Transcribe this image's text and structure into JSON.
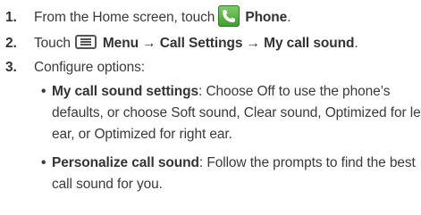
{
  "steps": [
    {
      "number": "1.",
      "text_before": "From the Home screen, touch",
      "icon": "phone-app-icon",
      "bold": "Phone",
      "text_after": "."
    },
    {
      "number": "2.",
      "text_before": "Touch",
      "icon": "menu-key-icon",
      "bold": "Menu → Call Settings → My call sound",
      "text_after": "."
    },
    {
      "number": "3.",
      "text": "Configure options:"
    }
  ],
  "options": [
    {
      "bullet": "•",
      "term": "My call sound settings",
      "line1": ": Choose Off to use the phone’s",
      "line2": "defaults, or choose Soft sound, Clear sound, Optimized for left",
      "line3": "ear, or Optimized for right ear."
    },
    {
      "bullet": "•",
      "term": "Personalize call sound",
      "line1": ": Follow the prompts to find the best",
      "line2": "call sound for you."
    }
  ],
  "colors": {
    "text": "#3a3a3a",
    "phone_icon_green": "#4caf3a"
  }
}
